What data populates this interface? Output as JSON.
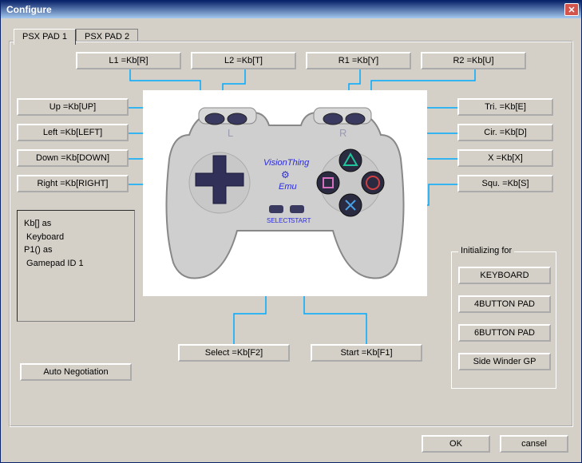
{
  "window": {
    "title": "Configure"
  },
  "tabs": {
    "tab1": "PSX PAD 1",
    "tab2": "PSX PAD 2"
  },
  "top": {
    "l1": "L1 =Kb[R]",
    "l2": "L2 =Kb[T]",
    "r1": "R1 =Kb[Y]",
    "r2": "R2 =Kb[U]"
  },
  "dpad": {
    "up": "Up =Kb[UP]",
    "left": "Left =Kb[LEFT]",
    "down": "Down =Kb[DOWN]",
    "right": "Right =Kb[RIGHT]"
  },
  "face": {
    "tri": "Tri. =Kb[E]",
    "cir": "Cir. =Kb[D]",
    "x": "X =Kb[X]",
    "squ": "Squ. =Kb[S]"
  },
  "center": {
    "select": "Select =Kb[F2]",
    "start": "Start =Kb[F1]"
  },
  "legend": {
    "line1": "Kb[] as",
    "line2": " Keyboard",
    "line3": "",
    "line4": "P1() as",
    "line5": " Gamepad ID 1"
  },
  "init": {
    "title": "Initializing for",
    "keyboard": "KEYBOARD",
    "pad4": "4BUTTON PAD",
    "pad6": "6BUTTON PAD",
    "swgp": "Side Winder GP"
  },
  "autoneg": "Auto Negotiation",
  "controller": {
    "brand1": "VisionThing",
    "brand2": "Emu",
    "select": "SELECT",
    "start": "START",
    "L": "L",
    "R": "R"
  },
  "footer": {
    "ok": "OK",
    "cancel": "cansel"
  }
}
